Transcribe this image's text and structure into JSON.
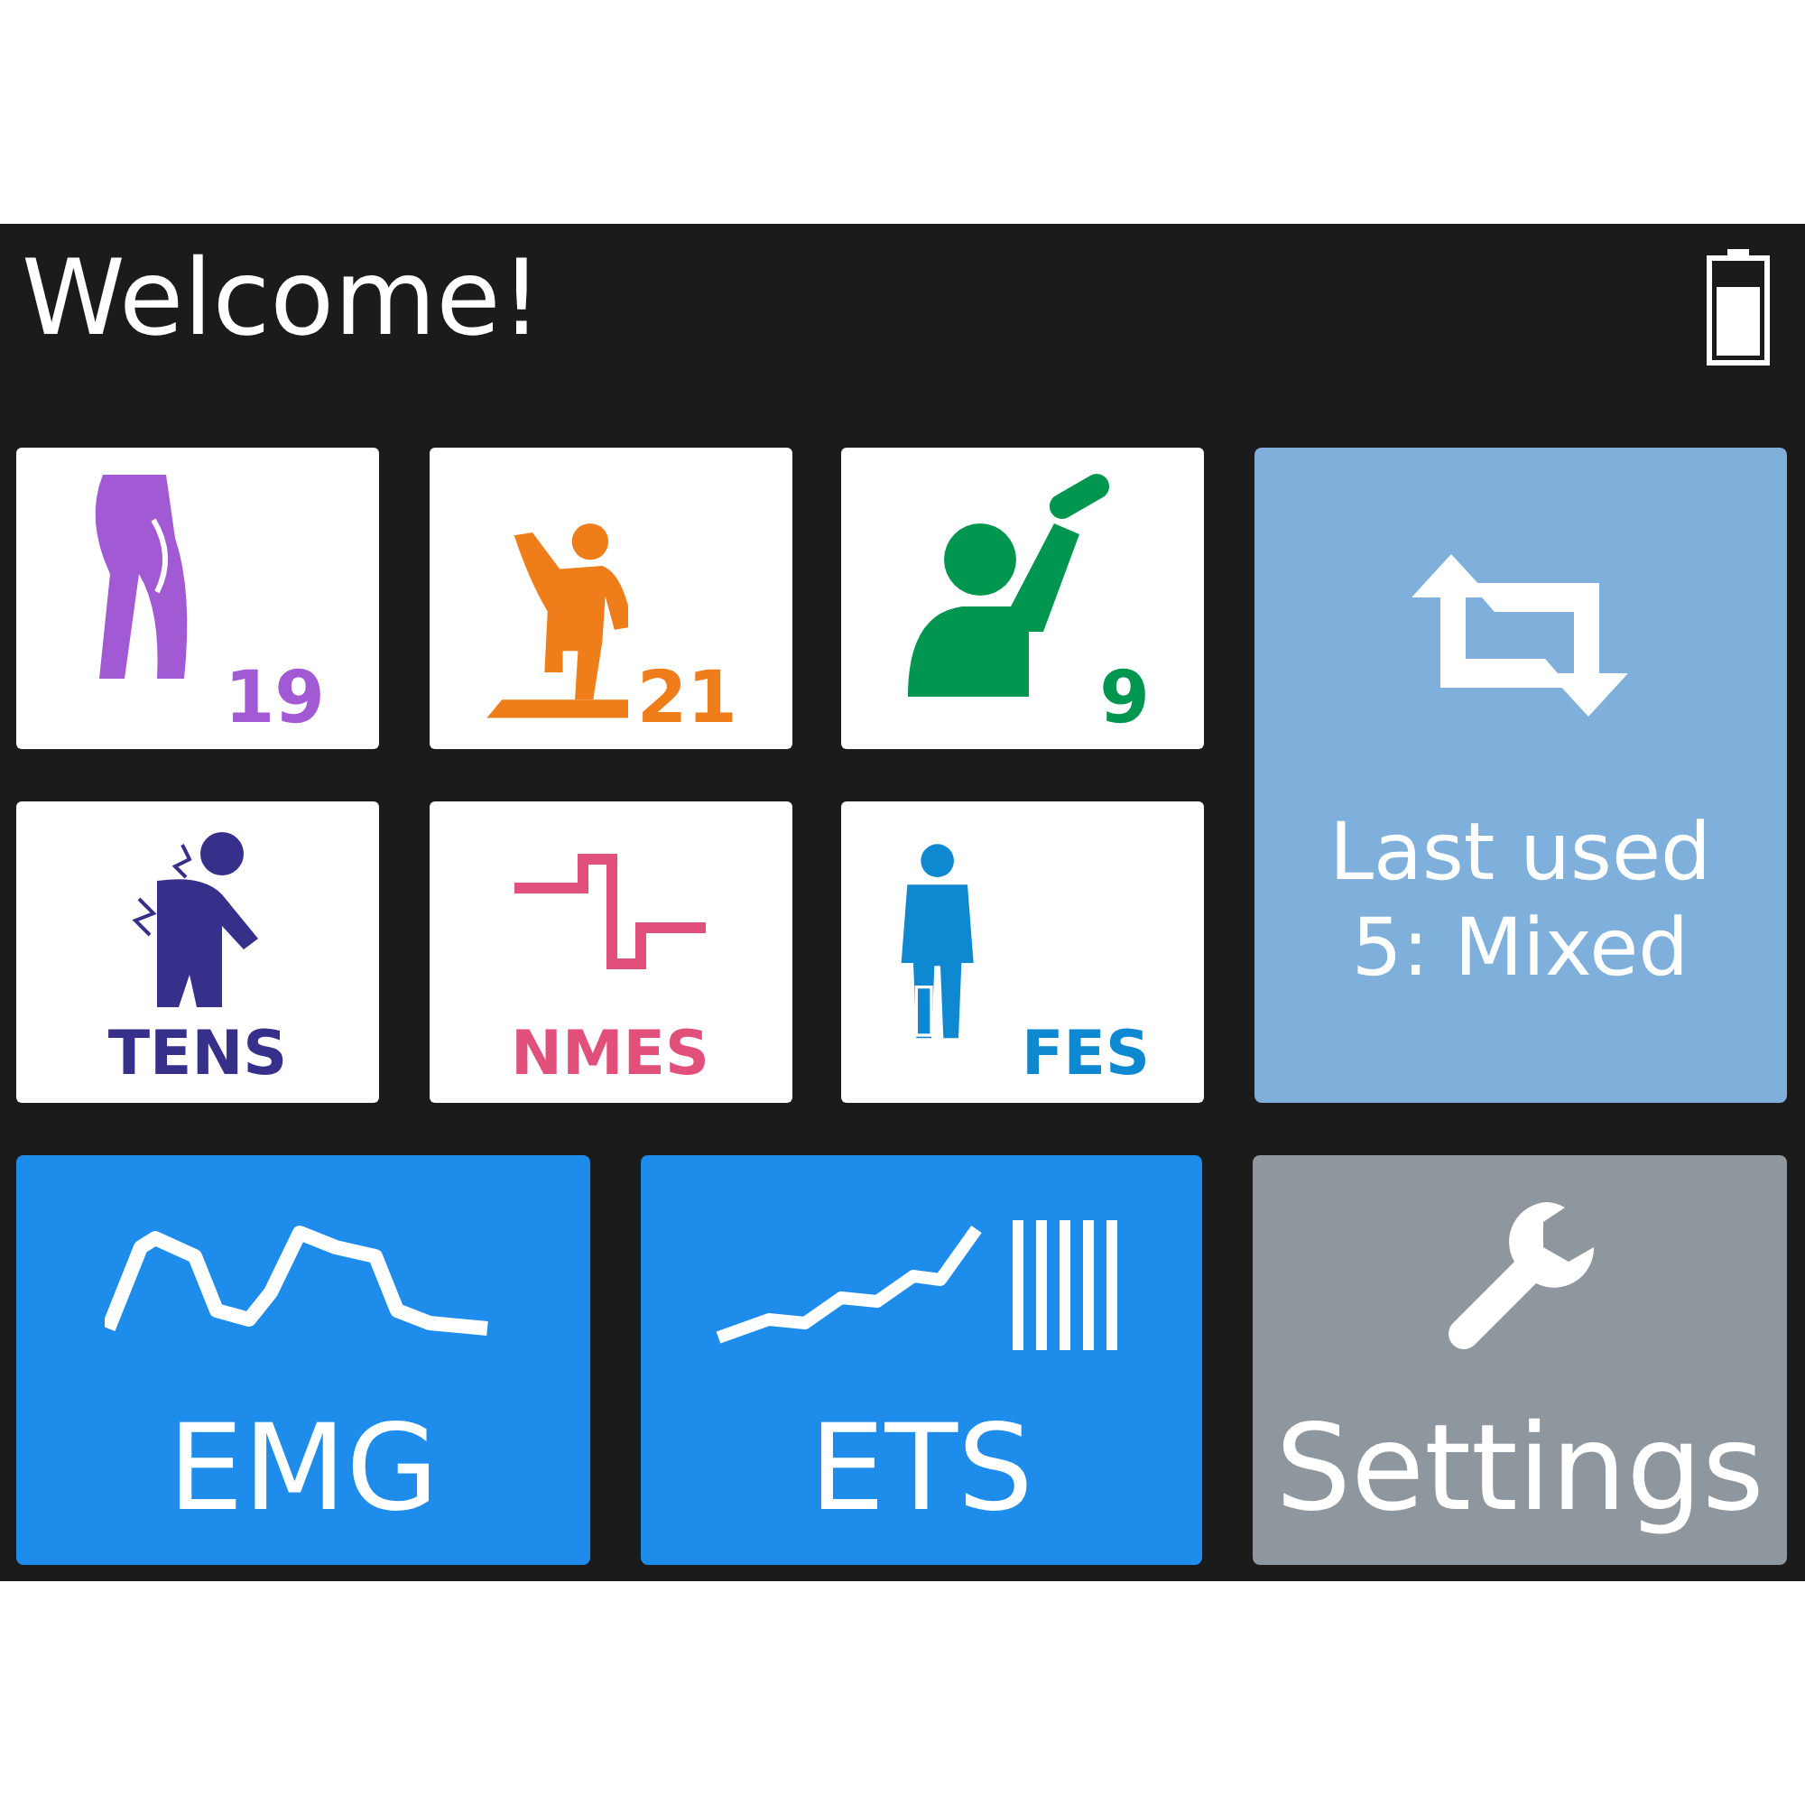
{
  "header": {
    "title": "Welcome!"
  },
  "programs": [
    {
      "kind": "count",
      "text": "19",
      "color": "#a259d4"
    },
    {
      "kind": "count",
      "text": "21",
      "color": "#ee7d1a"
    },
    {
      "kind": "count",
      "text": "9",
      "color": "#00964f"
    },
    {
      "kind": "label",
      "text": "TENS",
      "color": "#36308a"
    },
    {
      "kind": "label",
      "text": "NMES",
      "color": "#e0507a"
    },
    {
      "kind": "label",
      "text": "FES",
      "color": "#0e88d0"
    }
  ],
  "last_used": {
    "lines": [
      "Last used",
      "5: Mixed"
    ]
  },
  "modes": [
    {
      "kind": "emg",
      "label": "EMG"
    },
    {
      "kind": "ets",
      "label": "ETS"
    },
    {
      "kind": "settings",
      "label": "Settings"
    }
  ]
}
